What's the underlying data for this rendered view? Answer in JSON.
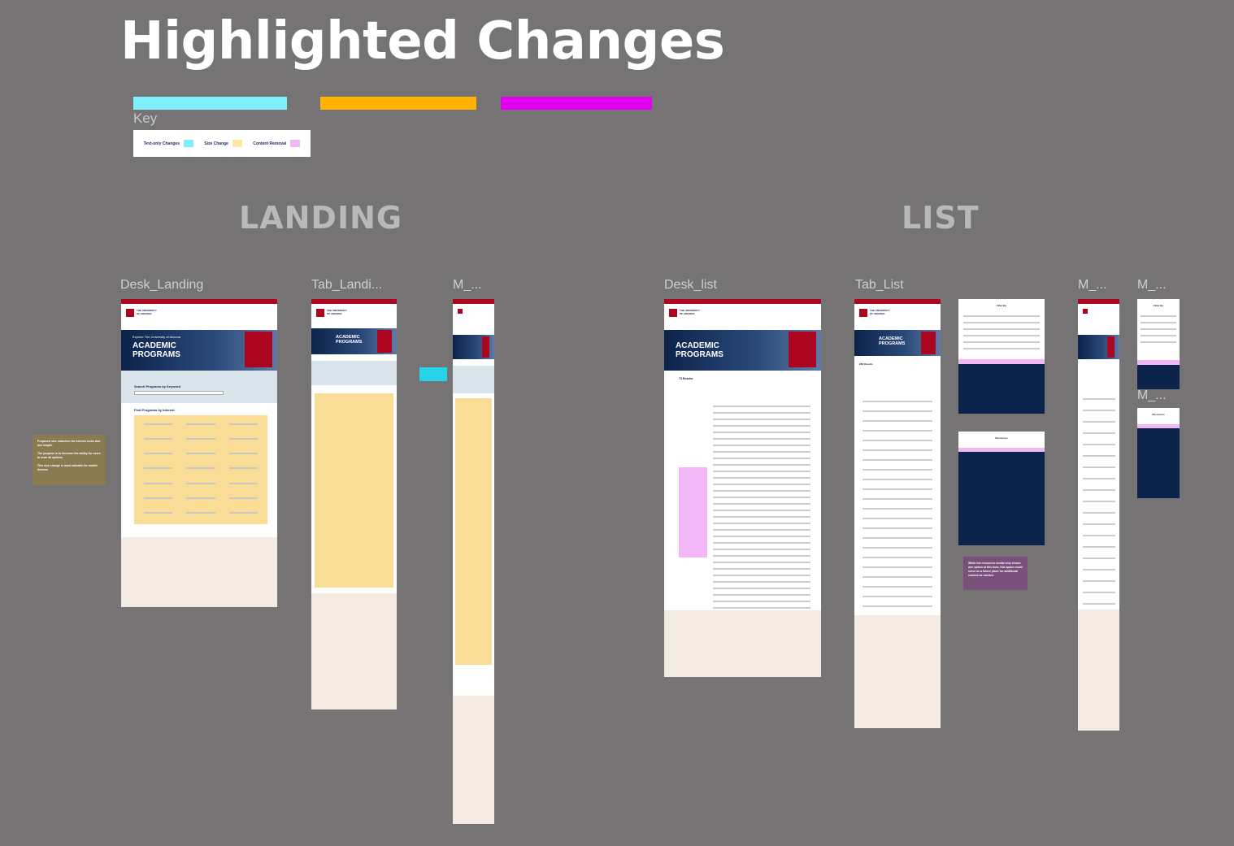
{
  "page": {
    "title": "Highlighted Changes"
  },
  "key": {
    "label": "Key",
    "items": [
      {
        "label": "Text-only Changes",
        "color": "#7eeefc"
      },
      {
        "label": "Size Change",
        "color": "#ffe7a4"
      },
      {
        "label": "Content Removal",
        "color": "#f2b7f7"
      }
    ],
    "bar_colors": [
      "#7eeefc",
      "#ffb300",
      "#e100f0"
    ]
  },
  "sections": {
    "landing": "LANDING",
    "list": "LIST"
  },
  "frames": {
    "desk_landing": "Desk_Landing",
    "tab_landing": "Tab_Landi...",
    "m_landing": "M_...",
    "desk_list": "Desk_list",
    "tab_list": "Tab_List",
    "m_list": "M_...",
    "m_list2": "M_...",
    "m_list3": "M_..."
  },
  "page_content": {
    "hero_kicker": "Explore The University of Arizona",
    "hero_title_line1": "ACADEMIC",
    "hero_title_line2": "PROGRAMS",
    "search_heading": "Search Programs by Keyword",
    "interest_heading": "Find Programs by Interest",
    "results_count": "73 Results",
    "results_count_tab": "288 Results",
    "filter_heading": "Filter By",
    "resources_heading": "Resources"
  },
  "notes": {
    "landing_note": "Proposed size reduction for interest icons and box height.\n\nThe purpose is to increase the ability for users to scan all options.\n\nThis size change is most valuable for mobile devices",
    "list_note": "While the resources modal only shows one option at this time, this space could serve as a future place for additional content as needed."
  }
}
